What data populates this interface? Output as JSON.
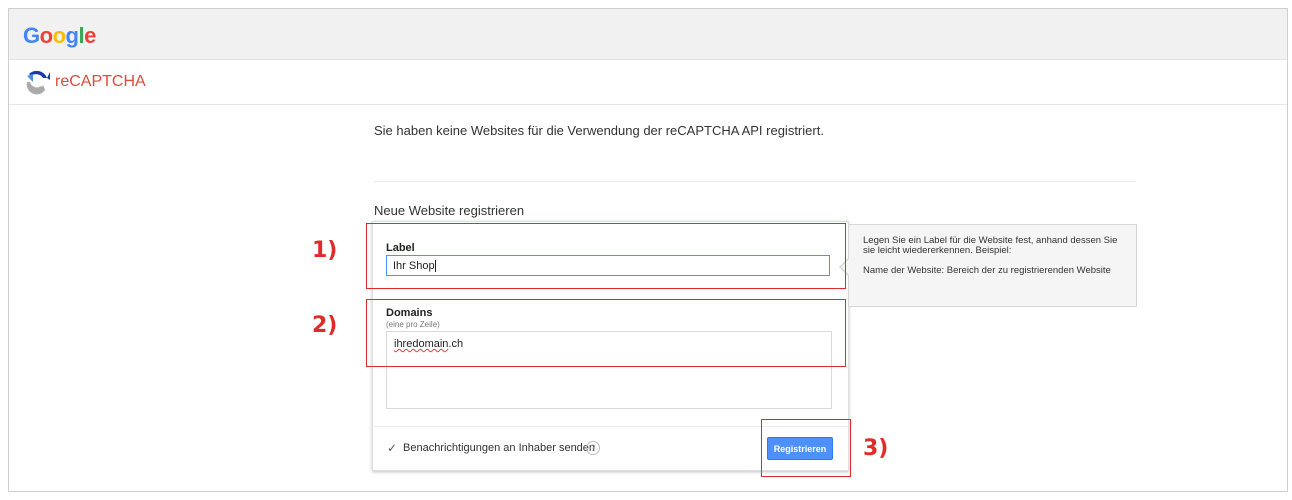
{
  "header": {
    "google_logo": [
      "G",
      "o",
      "o",
      "g",
      "l",
      "e"
    ],
    "google_colors": [
      "#4285f4",
      "#ea4335",
      "#fbbc05",
      "#4285f4",
      "#34a853",
      "#ea4335"
    ],
    "product_name": "reCAPTCHA"
  },
  "intro_text": "Sie haben keine Websites für die Verwendung der reCAPTCHA API registriert.",
  "register": {
    "section_title": "Neue Website registrieren",
    "label_field": {
      "label": "Label",
      "value": "Ihr Shop"
    },
    "domains_field": {
      "label": "Domains",
      "hint": "(eine pro Zeile)",
      "value_underlined": "ihredomain",
      "value_rest": ".ch"
    },
    "notify": {
      "label": "Benachrichtigungen an Inhaber senden",
      "checked": true,
      "help": "?"
    },
    "submit_label": "Registrieren"
  },
  "tooltip": {
    "line1": "Legen Sie ein Label für die Website fest, anhand dessen Sie sie leicht wiedererkennen. Beispiel:",
    "line2": "Name der Website: Bereich der zu registrierenden Website"
  },
  "annotations": [
    "1)",
    "2)",
    "3)"
  ],
  "colors": {
    "accent": "#4d90fe",
    "annotation": "#e02b2b",
    "recaptcha_red": "#dd4b39"
  }
}
